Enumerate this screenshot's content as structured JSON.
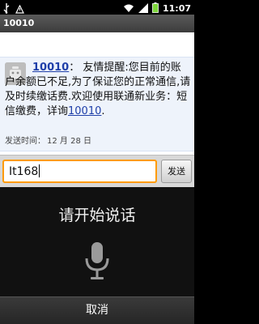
{
  "status_bar": {
    "time": "11:07",
    "icons": [
      "usb-icon",
      "wifi-icon",
      "signal-icon",
      "battery-icon"
    ]
  },
  "header": {
    "title": "10010"
  },
  "message": {
    "sender_link": "10010",
    "body_part1": "： 友情提醒:您目前的账户余额已不足,为了保证您的正常通信,请及时续缴话费.欢迎使用联通新业务：短信缴费，详询",
    "body_link": "10010",
    "body_end": ".",
    "time_label": "发送时间：",
    "time_value": "12 月 28 日"
  },
  "composer": {
    "input_value": "It168",
    "send_label": "发送"
  },
  "voice": {
    "title": "请开始说话",
    "mic_icon": "microphone-icon",
    "cancel_label": "取消"
  },
  "colors": {
    "accent_border": "#ff9b00",
    "link": "#1f3fa9"
  }
}
